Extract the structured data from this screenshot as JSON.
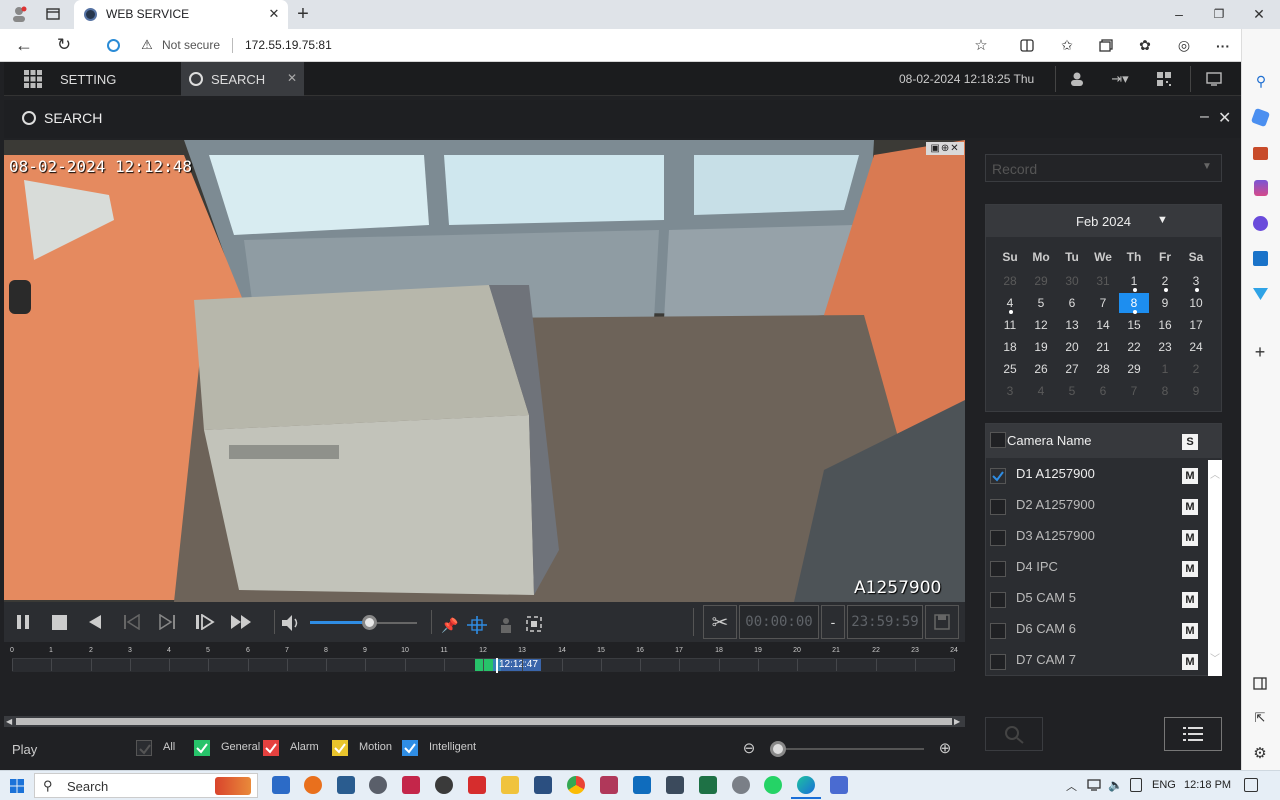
{
  "browser": {
    "tab_title": "WEB SERVICE",
    "not_secure": "Not secure",
    "url": "172.55.19.75:81"
  },
  "app": {
    "setting_label": "SETTING",
    "search_tab_label": "SEARCH",
    "datetime": "08-02-2024 12:18:25 Thu",
    "panel_title": "SEARCH"
  },
  "video": {
    "overlay_timestamp": "08-02-2024 12:12:48",
    "camera_label": "A1257900",
    "clip_start": "00:00:00",
    "clip_sep": "-",
    "clip_end": "23:59:59",
    "volume_fraction": 0.55
  },
  "timeline": {
    "hours": [
      "0",
      "1",
      "2",
      "3",
      "4",
      "5",
      "6",
      "7",
      "8",
      "9",
      "10",
      "11",
      "12",
      "13",
      "14",
      "15",
      "16",
      "17",
      "18",
      "19",
      "20",
      "21",
      "22",
      "23",
      "24"
    ],
    "cursor_time": "12:12:47"
  },
  "status": {
    "play_label": "Play",
    "filters": [
      {
        "label": "All",
        "color": "#2b2d31",
        "checked": true
      },
      {
        "label": "General",
        "color": "#27c36a",
        "checked": true
      },
      {
        "label": "Alarm",
        "color": "#e5413f",
        "checked": true
      },
      {
        "label": "Motion",
        "color": "#e9c42c",
        "checked": true
      },
      {
        "label": "Intelligent",
        "color": "#2f8de4",
        "checked": true
      }
    ]
  },
  "right": {
    "record_placeholder": "Record",
    "calendar": {
      "month_label": "Feb 2024",
      "weekdays": [
        "Su",
        "Mo",
        "Tu",
        "We",
        "Th",
        "Fr",
        "Sa"
      ],
      "days": [
        [
          "28",
          "29",
          "30",
          "31",
          "1",
          "2",
          "3"
        ],
        [
          "4",
          "5",
          "6",
          "7",
          "8",
          "9",
          "10"
        ],
        [
          "11",
          "12",
          "13",
          "14",
          "15",
          "16",
          "17"
        ],
        [
          "18",
          "19",
          "20",
          "21",
          "22",
          "23",
          "24"
        ],
        [
          "25",
          "26",
          "27",
          "28",
          "29",
          "1",
          "2"
        ],
        [
          "3",
          "4",
          "5",
          "6",
          "7",
          "8",
          "9"
        ]
      ],
      "selected": "8"
    },
    "camera_header": "Camera Name",
    "s_label": "S",
    "cameras": [
      {
        "name": "D1 A1257900",
        "checked": true
      },
      {
        "name": "D2 A1257900",
        "checked": false
      },
      {
        "name": "D3 A1257900",
        "checked": false
      },
      {
        "name": "D4 IPC",
        "checked": false
      },
      {
        "name": "D5 CAM 5",
        "checked": false
      },
      {
        "name": "D6 CAM 6",
        "checked": false
      },
      {
        "name": "D7 CAM 7",
        "checked": false
      }
    ],
    "m_label": "M"
  },
  "taskbar": {
    "search_label": "Search",
    "lang": "ENG",
    "time": "12:18 PM"
  }
}
